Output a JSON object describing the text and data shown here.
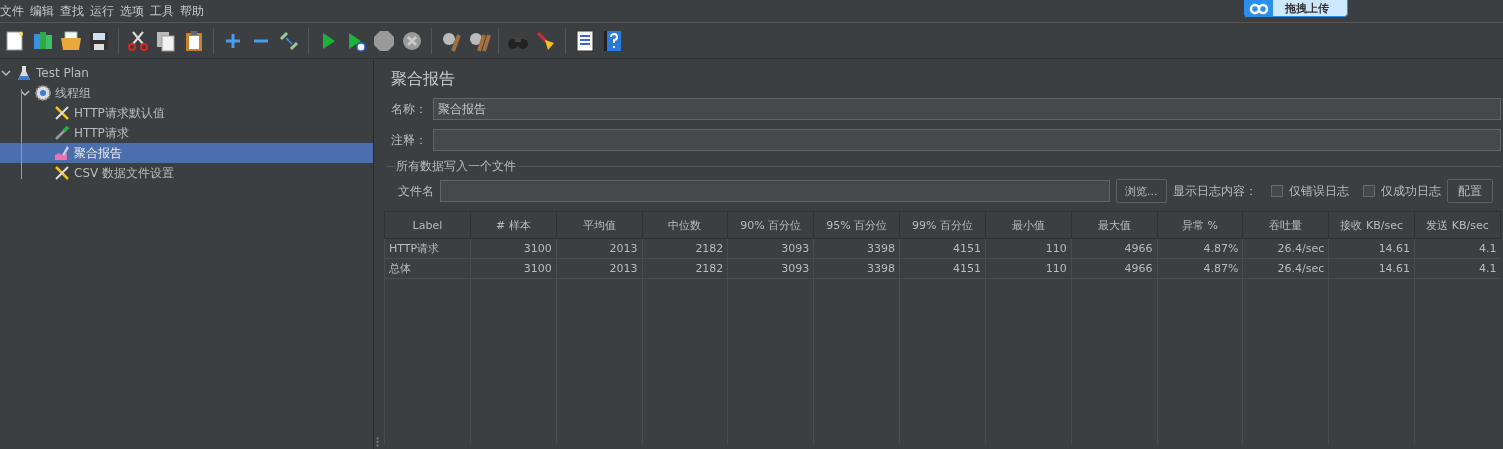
{
  "menu": [
    "文件",
    "编辑",
    "查找",
    "运行",
    "选项",
    "工具",
    "帮助"
  ],
  "upload_widget": {
    "label": "拖拽上传"
  },
  "tree": [
    {
      "label": "Test Plan",
      "kind": "plan",
      "expanded": true,
      "selected": false,
      "children": [
        {
          "label": "线程组",
          "kind": "group",
          "expanded": true,
          "selected": false,
          "children": [
            {
              "label": "HTTP请求默认值",
              "kind": "config",
              "selected": false
            },
            {
              "label": "HTTP请求",
              "kind": "sampler",
              "selected": false
            },
            {
              "label": "聚合报告",
              "kind": "listener",
              "selected": true
            },
            {
              "label": "CSV 数据文件设置",
              "kind": "config",
              "selected": false
            }
          ]
        }
      ]
    }
  ],
  "panel": {
    "title": "聚合报告",
    "name_field": {
      "label": "名称：",
      "value": "聚合报告"
    },
    "comment_field": {
      "label": "注释："
    },
    "file_group": {
      "title": "所有数据写入一个文件",
      "file_label": "文件名",
      "browse_button": "浏览...",
      "log_label": "显示日志内容：",
      "checkboxes": [
        {
          "label": "仅错误日志",
          "checked": false
        },
        {
          "label": "仅成功日志",
          "checked": false
        }
      ],
      "config_button": "配置"
    }
  },
  "table": {
    "columns": [
      "Label",
      "# 样本",
      "平均值",
      "中位数",
      "90% 百分位",
      "95% 百分位",
      "99% 百分位",
      "最小值",
      "最大值",
      "异常 %",
      "吞吐量",
      "接收 KB/sec",
      "发送 KB/sec"
    ],
    "rows": [
      [
        "HTTP请求",
        "3100",
        "2013",
        "2182",
        "3093",
        "3398",
        "4151",
        "110",
        "4966",
        "4.87%",
        "26.4/sec",
        "14.61",
        "4.1"
      ],
      [
        "总体",
        "3100",
        "2013",
        "2182",
        "3093",
        "3398",
        "4151",
        "110",
        "4966",
        "4.87%",
        "26.4/sec",
        "14.61",
        "4.1"
      ]
    ]
  }
}
